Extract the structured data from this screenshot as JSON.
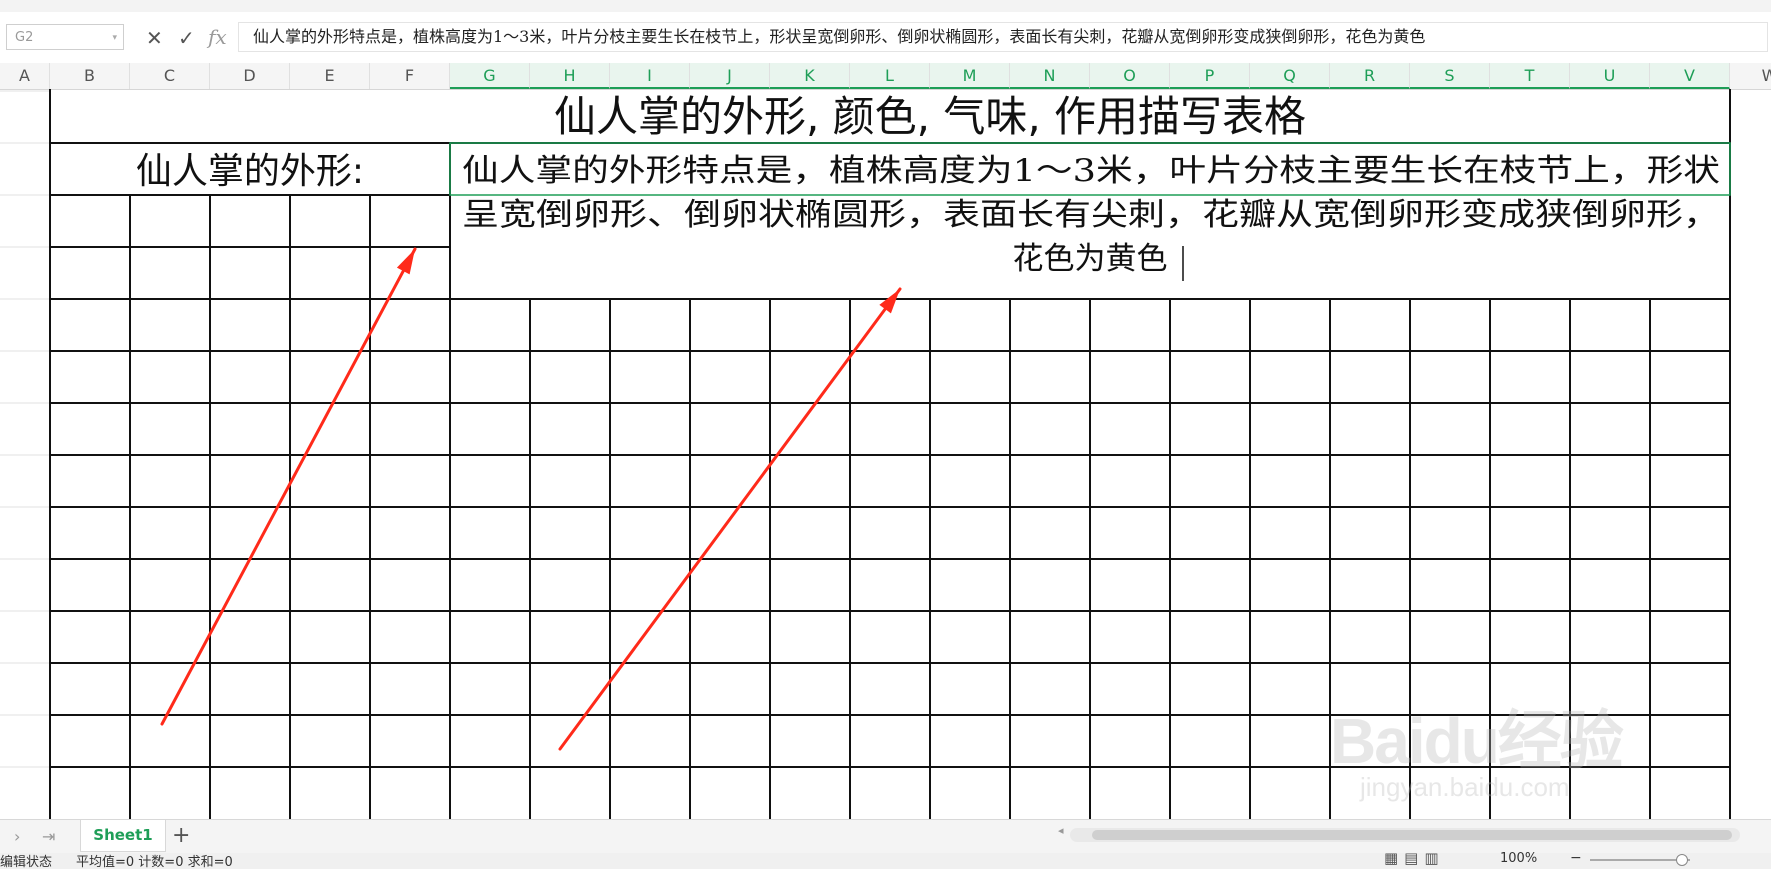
{
  "formula_bar": {
    "name_box": "G2",
    "cancel_icon": "close-icon",
    "confirm_icon": "check-icon",
    "fx_label": "fx",
    "content": "仙人掌的外形特点是，植株高度为1～3米，叶片分枝主要生长在枝节上，形状呈宽倒卵形、倒卵状椭圆形，表面长有尖刺，花瓣从宽倒卵形变成狭倒卵形，花色为黄色"
  },
  "columns": [
    "A",
    "B",
    "C",
    "D",
    "E",
    "F",
    "G",
    "H",
    "I",
    "J",
    "K",
    "L",
    "M",
    "N",
    "O",
    "P",
    "Q",
    "R",
    "S",
    "T",
    "U",
    "V",
    "W"
  ],
  "selected_columns": [
    "G",
    "H",
    "I",
    "J",
    "K",
    "L",
    "M",
    "N",
    "O",
    "P",
    "Q",
    "R",
    "S",
    "T",
    "U",
    "V"
  ],
  "sheet": {
    "title": "仙人掌的外形, 颜色, 气味, 作用描写表格",
    "row_label": "仙人掌的外形:",
    "cell_text": "仙人掌的外形特点是，植株高度为1～3米，叶片分枝主要生长在枝节上，形状呈宽倒卵形、倒卵状椭圆形，表面长有尖刺，花瓣从宽倒卵形变成狭倒卵形，花色为黄色",
    "cell_text_lines": [
      "仙人掌的外形特点是，植株高度为1～3米，叶片分枝主要生长在枝节上，形状",
      "呈宽倒卵形、倒卵状椭圆形，表面长有尖刺，花瓣从宽倒卵形变成狭倒卵形，",
      "花色为黄色"
    ]
  },
  "annotation_color": "#ff2a1a",
  "tabs": {
    "sheet_name": "Sheet1",
    "add_label": "+"
  },
  "status": {
    "mode": "编辑状态",
    "stats": "平均值=0  计数=0  求和=0",
    "zoom": "100%"
  },
  "watermark": {
    "logo": "Baidu经验",
    "url": "jingyan.baidu.com"
  }
}
